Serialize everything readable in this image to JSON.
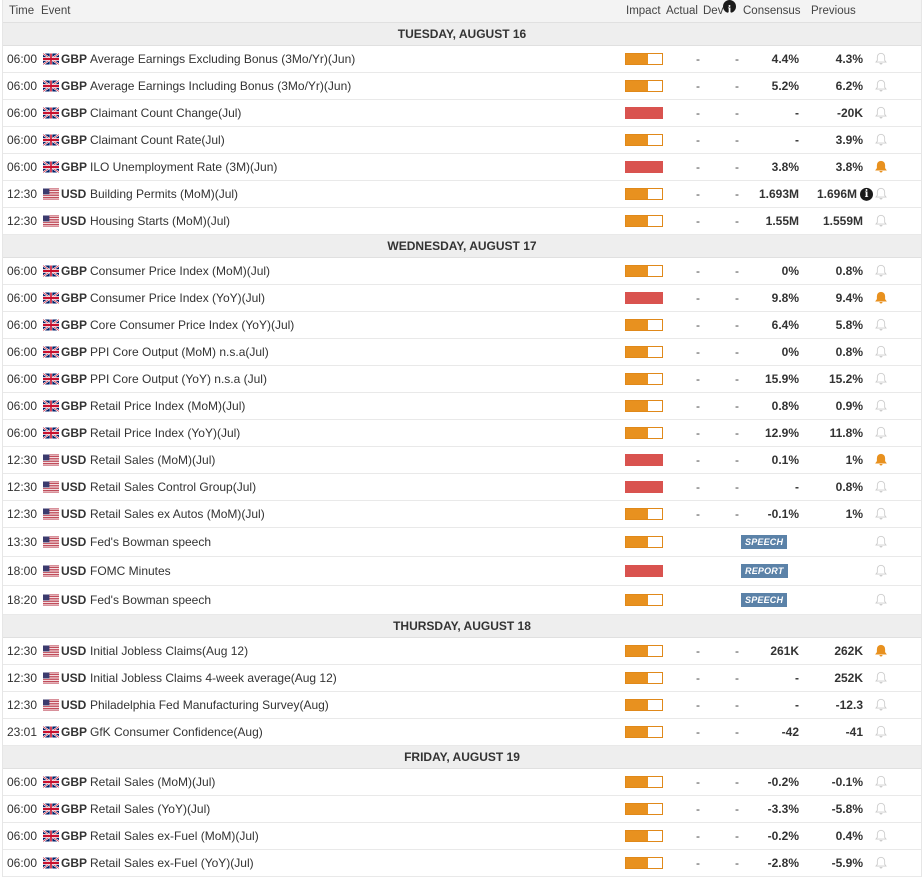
{
  "header": {
    "time": "Time",
    "event": "Event",
    "impact": "Impact",
    "actual": "Actual",
    "dev": "Dev",
    "consensus": "Consensus",
    "previous": "Previous",
    "info_icon": "i"
  },
  "colors": {
    "medium": "#e8911f",
    "high": "#d9534f",
    "bell_active": "#e8911f",
    "bell_inactive": "#cccccc",
    "badge": "#5b82a8"
  },
  "icons": {
    "bell": "bell-icon",
    "info": "info-icon",
    "flag_gb": "uk-flag-icon",
    "flag_us": "us-flag-icon"
  },
  "days": [
    {
      "label": "TUESDAY, AUGUST 16",
      "events": [
        {
          "time": "06:00",
          "ccy": "GBP",
          "name": "Average Earnings Excluding Bonus (3Mo/Yr)(Jun)",
          "impact": "medium",
          "impact_level": 0.6,
          "actual": "-",
          "dev": "-",
          "consensus": "4.4%",
          "previous": "4.3%",
          "bell": false
        },
        {
          "time": "06:00",
          "ccy": "GBP",
          "name": "Average Earnings Including Bonus (3Mo/Yr)(Jun)",
          "impact": "medium",
          "impact_level": 0.6,
          "actual": "-",
          "dev": "-",
          "consensus": "5.2%",
          "previous": "6.2%",
          "bell": false
        },
        {
          "time": "06:00",
          "ccy": "GBP",
          "name": "Claimant Count Change(Jul)",
          "impact": "high",
          "impact_level": 1,
          "actual": "-",
          "dev": "-",
          "consensus": "-",
          "previous": "-20K",
          "bell": false
        },
        {
          "time": "06:00",
          "ccy": "GBP",
          "name": "Claimant Count Rate(Jul)",
          "impact": "medium",
          "impact_level": 0.6,
          "actual": "-",
          "dev": "-",
          "consensus": "-",
          "previous": "3.9%",
          "bell": false
        },
        {
          "time": "06:00",
          "ccy": "GBP",
          "name": "ILO Unemployment Rate (3M)(Jun)",
          "impact": "high",
          "impact_level": 1,
          "actual": "-",
          "dev": "-",
          "consensus": "3.8%",
          "previous": "3.8%",
          "bell": true
        },
        {
          "time": "12:30",
          "ccy": "USD",
          "name": "Building Permits (MoM)(Jul)",
          "impact": "medium",
          "impact_level": 0.6,
          "actual": "-",
          "dev": "-",
          "consensus": "1.693M",
          "previous": "1.696M",
          "prev_info": true,
          "bell": false
        },
        {
          "time": "12:30",
          "ccy": "USD",
          "name": "Housing Starts (MoM)(Jul)",
          "impact": "medium",
          "impact_level": 0.6,
          "actual": "-",
          "dev": "-",
          "consensus": "1.55M",
          "previous": "1.559M",
          "bell": false
        }
      ]
    },
    {
      "label": "WEDNESDAY, AUGUST 17",
      "events": [
        {
          "time": "06:00",
          "ccy": "GBP",
          "name": "Consumer Price Index (MoM)(Jul)",
          "impact": "medium",
          "impact_level": 0.6,
          "actual": "-",
          "dev": "-",
          "consensus": "0%",
          "previous": "0.8%",
          "bell": false
        },
        {
          "time": "06:00",
          "ccy": "GBP",
          "name": "Consumer Price Index (YoY)(Jul)",
          "impact": "high",
          "impact_level": 1,
          "actual": "-",
          "dev": "-",
          "consensus": "9.8%",
          "previous": "9.4%",
          "bell": true
        },
        {
          "time": "06:00",
          "ccy": "GBP",
          "name": "Core Consumer Price Index (YoY)(Jul)",
          "impact": "medium",
          "impact_level": 0.6,
          "actual": "-",
          "dev": "-",
          "consensus": "6.4%",
          "previous": "5.8%",
          "bell": false
        },
        {
          "time": "06:00",
          "ccy": "GBP",
          "name": "PPI Core Output (MoM) n.s.a(Jul)",
          "impact": "medium",
          "impact_level": 0.6,
          "actual": "-",
          "dev": "-",
          "consensus": "0%",
          "previous": "0.8%",
          "bell": false
        },
        {
          "time": "06:00",
          "ccy": "GBP",
          "name": "PPI Core Output (YoY) n.s.a (Jul)",
          "impact": "medium",
          "impact_level": 0.6,
          "actual": "-",
          "dev": "-",
          "consensus": "15.9%",
          "previous": "15.2%",
          "bell": false
        },
        {
          "time": "06:00",
          "ccy": "GBP",
          "name": "Retail Price Index (MoM)(Jul)",
          "impact": "medium",
          "impact_level": 0.6,
          "actual": "-",
          "dev": "-",
          "consensus": "0.8%",
          "previous": "0.9%",
          "bell": false
        },
        {
          "time": "06:00",
          "ccy": "GBP",
          "name": "Retail Price Index (YoY)(Jul)",
          "impact": "medium",
          "impact_level": 0.6,
          "actual": "-",
          "dev": "-",
          "consensus": "12.9%",
          "previous": "11.8%",
          "bell": false
        },
        {
          "time": "12:30",
          "ccy": "USD",
          "name": "Retail Sales (MoM)(Jul)",
          "impact": "high",
          "impact_level": 1,
          "actual": "-",
          "dev": "-",
          "consensus": "0.1%",
          "previous": "1%",
          "bell": true
        },
        {
          "time": "12:30",
          "ccy": "USD",
          "name": "Retail Sales Control Group(Jul)",
          "impact": "high",
          "impact_level": 1,
          "actual": "-",
          "dev": "-",
          "consensus": "-",
          "previous": "0.8%",
          "bell": false
        },
        {
          "time": "12:30",
          "ccy": "USD",
          "name": "Retail Sales ex Autos (MoM)(Jul)",
          "impact": "medium",
          "impact_level": 0.6,
          "actual": "-",
          "dev": "-",
          "consensus": "-0.1%",
          "previous": "1%",
          "bell": false
        },
        {
          "time": "13:30",
          "ccy": "USD",
          "name": "Fed's Bowman speech",
          "impact": "medium",
          "impact_level": 0.6,
          "badge": "SPEECH",
          "bell": false
        },
        {
          "time": "18:00",
          "ccy": "USD",
          "name": "FOMC Minutes",
          "impact": "high",
          "impact_level": 1,
          "badge": "REPORT",
          "bell": false
        },
        {
          "time": "18:20",
          "ccy": "USD",
          "name": "Fed's Bowman speech",
          "impact": "medium",
          "impact_level": 0.6,
          "badge": "SPEECH",
          "bell": false
        }
      ]
    },
    {
      "label": "THURSDAY, AUGUST 18",
      "events": [
        {
          "time": "12:30",
          "ccy": "USD",
          "name": "Initial Jobless Claims(Aug 12)",
          "impact": "medium",
          "impact_level": 0.6,
          "actual": "-",
          "dev": "-",
          "consensus": "261K",
          "previous": "262K",
          "bell": true
        },
        {
          "time": "12:30",
          "ccy": "USD",
          "name": "Initial Jobless Claims 4-week average(Aug 12)",
          "impact": "medium",
          "impact_level": 0.6,
          "actual": "-",
          "dev": "-",
          "consensus": "-",
          "previous": "252K",
          "bell": false
        },
        {
          "time": "12:30",
          "ccy": "USD",
          "name": "Philadelphia Fed Manufacturing Survey(Aug)",
          "impact": "medium",
          "impact_level": 0.6,
          "actual": "-",
          "dev": "-",
          "consensus": "-",
          "previous": "-12.3",
          "bell": false
        },
        {
          "time": "23:01",
          "ccy": "GBP",
          "name": "GfK Consumer Confidence(Aug)",
          "impact": "medium",
          "impact_level": 0.6,
          "actual": "-",
          "dev": "-",
          "consensus": "-42",
          "previous": "-41",
          "bell": false
        }
      ]
    },
    {
      "label": "FRIDAY, AUGUST 19",
      "events": [
        {
          "time": "06:00",
          "ccy": "GBP",
          "name": "Retail Sales (MoM)(Jul)",
          "impact": "medium",
          "impact_level": 0.6,
          "actual": "-",
          "dev": "-",
          "consensus": "-0.2%",
          "previous": "-0.1%",
          "bell": false
        },
        {
          "time": "06:00",
          "ccy": "GBP",
          "name": "Retail Sales (YoY)(Jul)",
          "impact": "medium",
          "impact_level": 0.6,
          "actual": "-",
          "dev": "-",
          "consensus": "-3.3%",
          "previous": "-5.8%",
          "bell": false
        },
        {
          "time": "06:00",
          "ccy": "GBP",
          "name": "Retail Sales ex-Fuel (MoM)(Jul)",
          "impact": "medium",
          "impact_level": 0.6,
          "actual": "-",
          "dev": "-",
          "consensus": "-0.2%",
          "previous": "0.4%",
          "bell": false
        },
        {
          "time": "06:00",
          "ccy": "GBP",
          "name": "Retail Sales ex-Fuel (YoY)(Jul)",
          "impact": "medium",
          "impact_level": 0.6,
          "actual": "-",
          "dev": "-",
          "consensus": "-2.8%",
          "previous": "-5.9%",
          "bell": false
        }
      ]
    }
  ]
}
